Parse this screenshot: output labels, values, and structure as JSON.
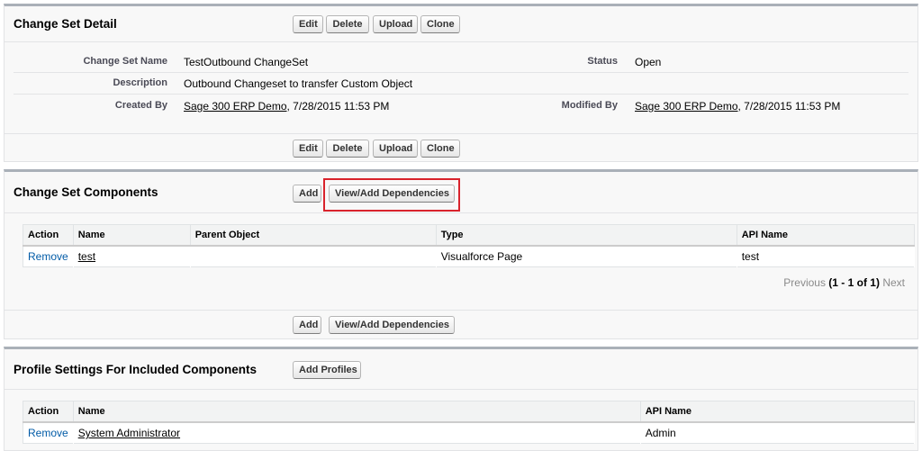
{
  "detail": {
    "title": "Change Set Detail",
    "buttons": [
      "Edit",
      "Delete",
      "Upload",
      "Clone"
    ],
    "fields": {
      "name_label": "Change Set Name",
      "name_value": "TestOutbound ChangeSet",
      "status_label": "Status",
      "status_value": "Open",
      "description_label": "Description",
      "description_value": "Outbound Changeset to transfer Custom Object",
      "created_label": "Created By",
      "created_user": "Sage 300 ERP Demo",
      "created_date": ", 7/28/2015 11:53 PM",
      "modified_label": "Modified By",
      "modified_user": "Sage 300 ERP Demo",
      "modified_date": ", 7/28/2015 11:53 PM"
    }
  },
  "components": {
    "title": "Change Set Components",
    "add_label": "Add",
    "deps_label": "View/Add Dependencies",
    "columns": [
      "Action",
      "Name",
      "Parent Object",
      "Type",
      "API Name"
    ],
    "rows": [
      {
        "action": "Remove",
        "name": "test",
        "parent": "",
        "type": "Visualforce Page",
        "api": "test"
      }
    ],
    "pager": {
      "previous": "Previous",
      "range": "(1 - 1 of 1)",
      "next": "Next"
    }
  },
  "profiles": {
    "title": "Profile Settings For Included Components",
    "add_label": "Add Profiles",
    "columns": [
      "Action",
      "Name",
      "API Name"
    ],
    "rows": [
      {
        "action": "Remove",
        "name": "System Administrator",
        "api": "Admin"
      }
    ]
  },
  "colors": {
    "highlight": "#d9232c",
    "link": "#015ba7",
    "panel_border": "#aab0b8"
  }
}
